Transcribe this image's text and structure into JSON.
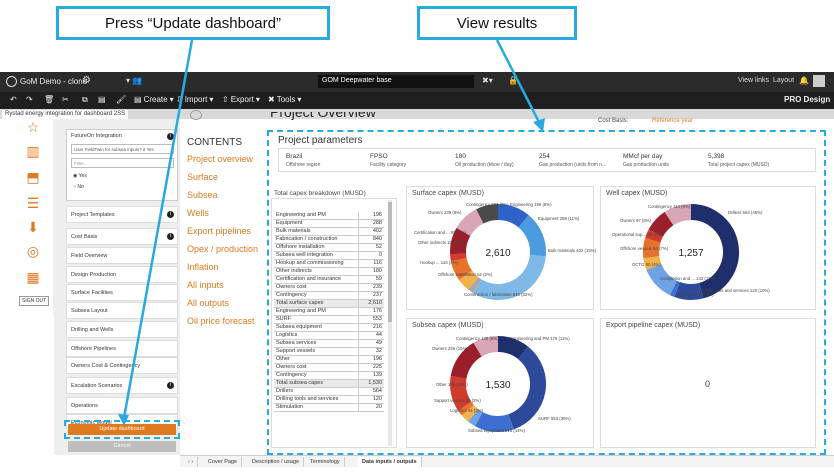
{
  "callouts": {
    "left": "Press “Update dashboard”",
    "right": "View results"
  },
  "app": {
    "title": "GoM Demo - clone",
    "doc_name": "GOM Deepwater base",
    "view_links": "View links",
    "layout": "Layout",
    "pro_design": "PRO Design"
  },
  "toolbar": {
    "create": "Create",
    "import": "Import",
    "export": "Export",
    "tools": "Tools"
  },
  "tab_title": "Rystad energy integration for dashboard 2SS",
  "panel": {
    "integration_title": "FutureOn Integration",
    "select_value": "User FieldTwin for subsea inputs? it Yes",
    "filter_placeholder": "Filter...",
    "radio_yes": "Yes",
    "radio_no": "No",
    "items": [
      "Project Templates",
      "Cost Basis",
      "Field Overview",
      "Design Production",
      "Surface Facilities",
      "Subsea Layout",
      "Drilling and Wells",
      "Offshore Pipelines",
      "Owners Cost & Contingency",
      "Escalation Scenarios",
      "Operations",
      "Economic Model"
    ],
    "update": "Update dashboard",
    "cancel": "Cancel",
    "sign_out": "SIGN OUT"
  },
  "main": {
    "overview_heading": "Project Overview",
    "cost_basis_label": "Cost Basis:",
    "cost_basis_value": "Reference year",
    "contents_title": "CONTENTS",
    "toc": [
      "Project overview",
      "Surface",
      "Subsea",
      "Wells",
      "Export pipelines",
      "Opex / production",
      "Inflation",
      "All inputs",
      "All outputs",
      "Oil price forecast"
    ]
  },
  "project_parameters": {
    "title": "Project parameters",
    "cells": [
      {
        "value": "Brazil",
        "label": "Offshore region"
      },
      {
        "value": "FPSO",
        "label": "Facility category"
      },
      {
        "value": "180",
        "label": "Oil production (kboe / day)"
      },
      {
        "value": "254",
        "label": "Gas production (units from n..."
      },
      {
        "value": "MMcf per day",
        "label": "Gas production units"
      },
      {
        "value": "5,398",
        "label": "Total project capex (MUSD)"
      }
    ]
  },
  "capex_table": {
    "title": "Total capex breakdown (MUSD)",
    "rows": [
      [
        "Engineering and PM",
        "196"
      ],
      [
        "Equipment",
        "288"
      ],
      [
        "Bulk materials",
        "402"
      ],
      [
        "Fabrication / construction",
        "840"
      ],
      [
        "Offshore installation",
        "52"
      ],
      [
        "Subsea well integration",
        "0"
      ],
      [
        "Hookup and commissioning",
        "116"
      ],
      [
        "Other indirects",
        "180"
      ],
      [
        "Certification and insurance",
        "59"
      ],
      [
        "Owners cost",
        "239"
      ],
      [
        "Contingency",
        "237"
      ],
      [
        "Total surface capex",
        "2,610"
      ],
      [
        "Engineering and PM",
        "176"
      ],
      [
        "SURF",
        "553"
      ],
      [
        "Subsea equipment",
        "216"
      ],
      [
        "Logistics",
        "44"
      ],
      [
        "Subsea services",
        "49"
      ],
      [
        "Support vessels",
        "32"
      ],
      [
        "Other",
        "196"
      ],
      [
        "Owners cost",
        "225"
      ],
      [
        "Contingency",
        "139"
      ],
      [
        "Total subsea capex",
        "1,530"
      ],
      [
        "Drillers",
        "564"
      ],
      [
        "Drilling tools and services",
        "120"
      ],
      [
        "Stimulation",
        "20"
      ]
    ]
  },
  "chart_data": [
    {
      "type": "pie",
      "title": "Surface capex (MUSD)",
      "total": "2,610",
      "colors": [
        "#2d63c8",
        "#4c9be0",
        "#7fb9e8",
        "#a8a8a8",
        "#f1b24a",
        "#e8722c",
        "#d13b2e",
        "#9b1f2b",
        "#d8a6b7",
        "#4a4a4a",
        "#2bb3b1"
      ],
      "labels": [
        "Equipment 288 (11%)",
        "Bulk materials 402 (15%)",
        "Construction / fabrication 840 (32%)",
        "Offshore installation 52 (2%)",
        "Hookup ... 116 (4%)",
        "Other indirects 180 (7%)",
        "Certification and ... 59 (2%)",
        "Owners 239 (9%)",
        "Contingency 237 (9%)",
        "Engineering 196 (8%)"
      ],
      "values": [
        288,
        402,
        840,
        52,
        116,
        180,
        59,
        239,
        237,
        196
      ]
    },
    {
      "type": "pie",
      "title": "Well capex (MUSD)",
      "total": "1,257",
      "colors": [
        "#1f2f6b",
        "#2d4a9a",
        "#3d6fd0",
        "#6fa3e6",
        "#f1b24a",
        "#e8722c",
        "#d13b2e",
        "#9b1f2b",
        "#d8a6b7"
      ],
      "labels": [
        "Drillers 564 (45%)",
        "Drilling tools and services 120 (10%)",
        "Stimulation 20 (2%)",
        "Completion and ... 143 (11%)",
        "OCTG 50 (4%)",
        "Offshore vessels 84 (7%)",
        "Operational sup... 38 (3%)",
        "Owners 97 (8%)",
        "Contingency 114 (9%)"
      ],
      "values": [
        564,
        120,
        20,
        143,
        50,
        84,
        38,
        97,
        114
      ]
    },
    {
      "type": "pie",
      "title": "Subsea capex (MUSD)",
      "total": "1,530",
      "colors": [
        "#1f2f6b",
        "#2d4a9a",
        "#3d6fd0",
        "#6fa3e6",
        "#f1b24a",
        "#e8722c",
        "#d13b2e",
        "#9b1f2b",
        "#d8a6b7"
      ],
      "labels": [
        "Engineering and PM 176 (11%)",
        "SURF 553 (36%)",
        "Subsea equipment 216 (14%)",
        "Logistics 44 (3%)",
        "Support vessels 32 (2%)",
        "Other 196 (13%)",
        "Owners 225 (15%)",
        "Contingency 139 (9%)"
      ],
      "values": [
        176,
        553,
        216,
        44,
        49,
        32,
        196,
        225,
        139
      ]
    },
    {
      "type": "pie",
      "title": "Export pipeline capex (MUSD)",
      "total": "0",
      "values": []
    }
  ],
  "bottom_tabs": [
    "Cover Page",
    "Description / usage",
    "Terminology",
    "Data inputs / outputs"
  ]
}
